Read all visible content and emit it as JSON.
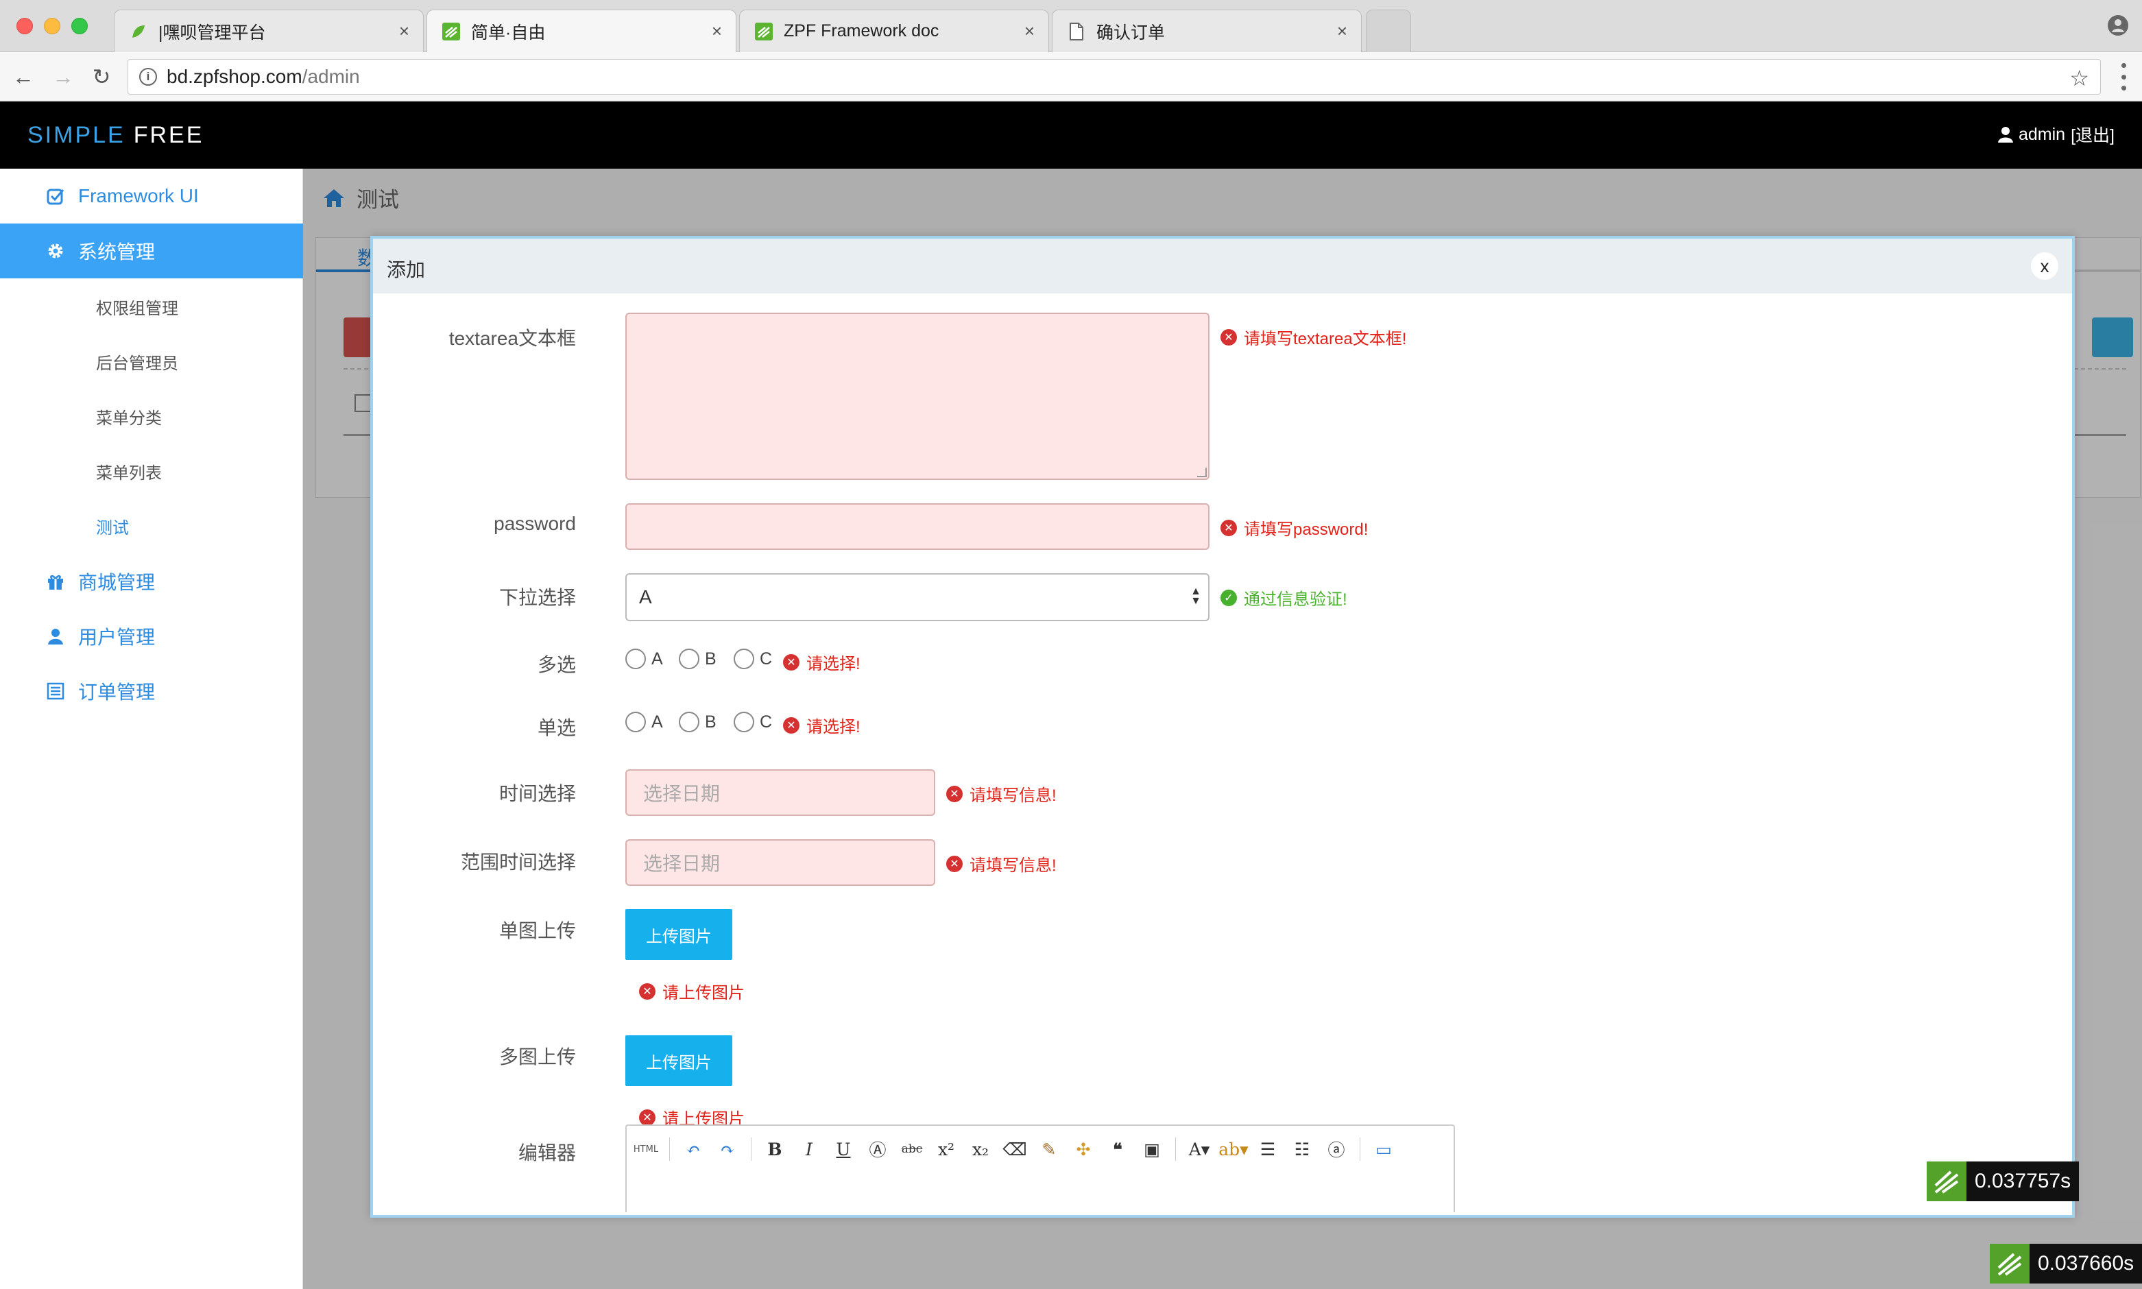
{
  "browser": {
    "tabs": [
      {
        "title": "|嘿呗管理平台",
        "close": "×"
      },
      {
        "title": "简单·自由",
        "close": "×"
      },
      {
        "title": "ZPF Framework doc",
        "close": "×"
      },
      {
        "title": "确认订单",
        "close": "×"
      }
    ],
    "url_host": "bd.zpfshop.com",
    "url_path": "/admin"
  },
  "header": {
    "brand_1": "SIMPLE",
    "brand_2": "FREE",
    "user": "admin",
    "logout": "[退出]"
  },
  "sidebar": {
    "items": [
      {
        "label": "Framework UI",
        "icon": "checkbox-icon"
      },
      {
        "label": "系统管理",
        "icon": "gear-icon"
      },
      {
        "label": "商城管理",
        "icon": "gift-icon"
      },
      {
        "label": "用户管理",
        "icon": "user-icon"
      },
      {
        "label": "订单管理",
        "icon": "list-icon"
      }
    ],
    "subitems": [
      "权限组管理",
      "后台管理员",
      "菜单分类",
      "菜单列表",
      "测试"
    ]
  },
  "content": {
    "breadcrumb": "测试",
    "tab_partial": "数"
  },
  "modal": {
    "title": "添加",
    "close": "x",
    "fields": {
      "textarea_label": "textarea文本框",
      "textarea_error": "请填写textarea文本框!",
      "password_label": "password",
      "password_error": "请填写password!",
      "select_label": "下拉选择",
      "select_value": "A",
      "select_ok": "通过信息验证!",
      "multi_label": "多选",
      "multi_options": [
        "A",
        "B",
        "C"
      ],
      "multi_error": "请选择!",
      "single_label": "单选",
      "single_options": [
        "A",
        "B",
        "C"
      ],
      "single_error": "请选择!",
      "time_label": "时间选择",
      "time_placeholder": "选择日期",
      "time_error": "请填写信息!",
      "range_label": "范围时间选择",
      "range_placeholder": "选择日期",
      "range_error": "请填写信息!",
      "single_upload_label": "单图上传",
      "single_upload_button": "上传图片",
      "single_upload_error": "请上传图片",
      "multi_upload_label": "多图上传",
      "multi_upload_button": "上传图片",
      "multi_upload_error": "请上传图片",
      "editor_label": "编辑器"
    }
  },
  "timing": {
    "modal_badge": "0.037757s",
    "page_badge": "0.037660s"
  },
  "colors": {
    "accent": "#3aa3f5",
    "error": "#e2231a",
    "ok": "#4bb22c",
    "upload": "#16b0ec"
  }
}
